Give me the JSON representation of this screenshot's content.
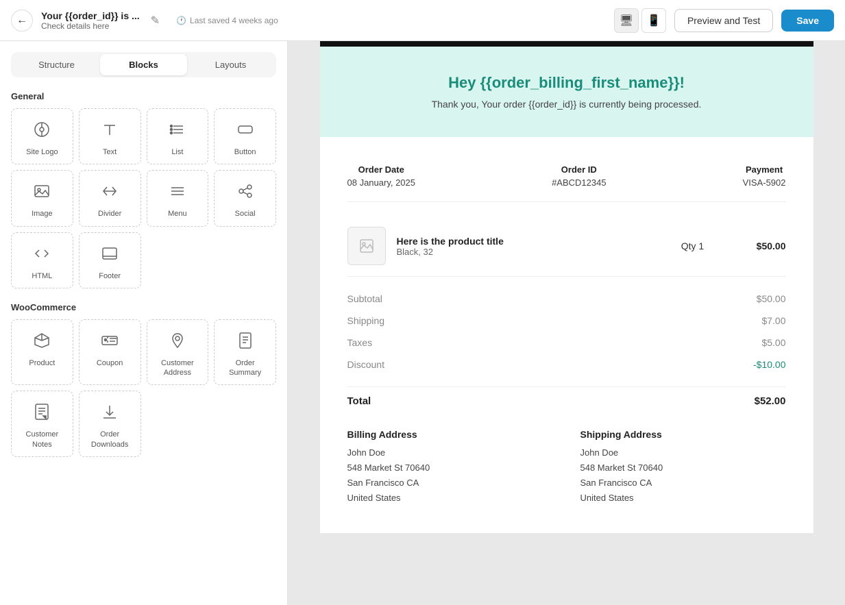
{
  "topbar": {
    "back_label": "←",
    "title": "Your {{order_id}} is ...",
    "subtitle": "Check details here",
    "edit_icon": "✎",
    "saved_text": "Last saved 4 weeks ago",
    "desktop_icon": "🖥",
    "mobile_icon": "📱",
    "preview_label": "Preview and Test",
    "save_label": "Save"
  },
  "sidebar": {
    "tabs": [
      "Structure",
      "Blocks",
      "Layouts"
    ],
    "active_tab": "Blocks",
    "general_label": "General",
    "woocommerce_label": "WooCommerce",
    "general_blocks": [
      {
        "id": "site-logo",
        "label": "Site Logo",
        "icon": "⊙"
      },
      {
        "id": "text",
        "label": "Text",
        "icon": "T"
      },
      {
        "id": "list",
        "label": "List",
        "icon": "≡"
      },
      {
        "id": "button",
        "label": "Button",
        "icon": "▭"
      },
      {
        "id": "image",
        "label": "Image",
        "icon": "🖼"
      },
      {
        "id": "divider",
        "label": "Divider",
        "icon": "⇅"
      },
      {
        "id": "menu",
        "label": "Menu",
        "icon": "☰"
      },
      {
        "id": "social",
        "label": "Social",
        "icon": "⇌"
      },
      {
        "id": "html",
        "label": "HTML",
        "icon": "</>"
      },
      {
        "id": "footer",
        "label": "Footer",
        "icon": "▭"
      }
    ],
    "woo_blocks": [
      {
        "id": "product",
        "label": "Product",
        "icon": "◈"
      },
      {
        "id": "coupon",
        "label": "Coupon",
        "icon": "🎟"
      },
      {
        "id": "customer-address",
        "label": "Customer Address",
        "icon": "📍"
      },
      {
        "id": "order-summary",
        "label": "Order Summary",
        "icon": "📄"
      },
      {
        "id": "customer-notes",
        "label": "Customer Notes",
        "icon": "📋"
      },
      {
        "id": "order-downloads",
        "label": "Order Downloads",
        "icon": "⬇"
      }
    ]
  },
  "preview": {
    "hero_heading": "Hey {{order_billing_first_name}}!",
    "hero_subtext": "Thank you, Your order {{order_id}} is currently being processed.",
    "order_date_label": "Order Date",
    "order_date_value": "08 January, 2025",
    "order_id_label": "Order ID",
    "order_id_value": "#ABCD12345",
    "payment_label": "Payment",
    "payment_value": "VISA-5902",
    "product_title": "Here is the product title",
    "product_variant": "Black, 32",
    "product_qty": "Qty 1",
    "product_price": "$50.00",
    "subtotal_label": "Subtotal",
    "subtotal_value": "$50.00",
    "shipping_label": "Shipping",
    "shipping_value": "$7.00",
    "taxes_label": "Taxes",
    "taxes_value": "$5.00",
    "discount_label": "Discount",
    "discount_value": "-$10.00",
    "total_label": "Total",
    "total_value": "$52.00",
    "billing_title": "Billing Address",
    "billing_name": "John Doe",
    "billing_street": "548 Market St 70640",
    "billing_city": "San Francisco CA",
    "billing_country": "United States",
    "shipping_title": "Shipping Address",
    "shipping_name": "John Doe",
    "shipping_street": "548 Market St 70640",
    "shipping_city": "San Francisco CA",
    "shipping_country": "United States"
  }
}
